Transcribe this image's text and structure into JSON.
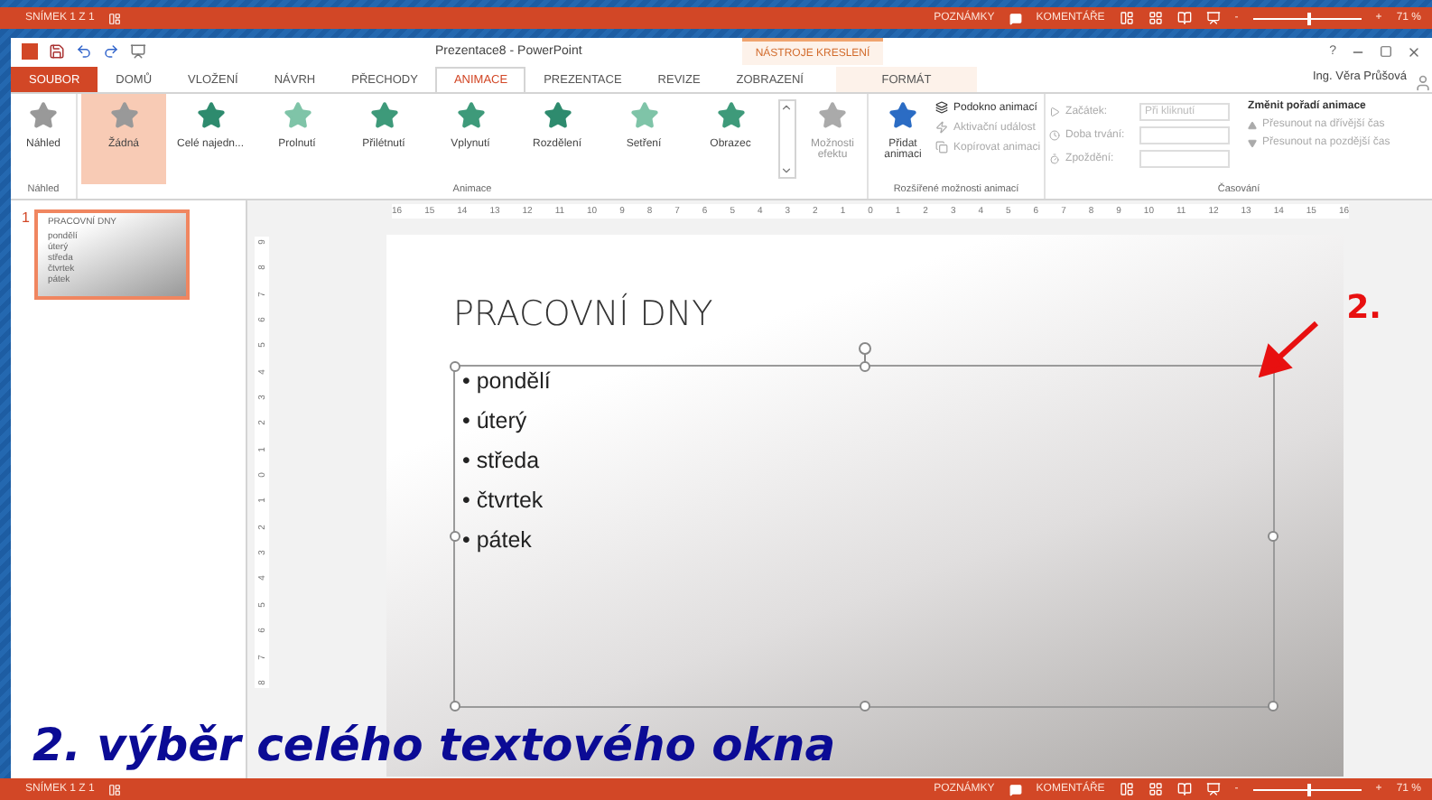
{
  "top_status_bar": {
    "slide_counter": "SNÍMEK 1 Z 1",
    "notes": "POZNÁMKY",
    "comments": "KOMENTÁŘE",
    "zoom_minus": "-",
    "zoom_plus": "+",
    "zoom": {
      "level": 0.5
    },
    "zoom_reading": "71 %"
  },
  "window": {
    "title": "Prezentace8 - PowerPoint",
    "contextual_group": "NÁSTROJE KRESLENÍ",
    "help": "?",
    "user": "Ing. Věra Průšová"
  },
  "tabs": [
    {
      "label": "SOUBOR",
      "kind": "file",
      "selected": false
    },
    {
      "label": "DOMŮ",
      "kind": "normal",
      "selected": false
    },
    {
      "label": "VLOŽENÍ",
      "kind": "normal",
      "selected": false
    },
    {
      "label": "NÁVRH",
      "kind": "normal",
      "selected": false
    },
    {
      "label": "PŘECHODY",
      "kind": "normal",
      "selected": false
    },
    {
      "label": "ANIMACE",
      "kind": "normal",
      "selected": true
    },
    {
      "label": "PREZENTACE",
      "kind": "normal",
      "selected": false
    },
    {
      "label": "REVIZE",
      "kind": "normal",
      "selected": false
    },
    {
      "label": "ZOBRAZENÍ",
      "kind": "normal",
      "selected": false
    },
    {
      "label": "FORMÁT",
      "kind": "contextual",
      "selected": false
    }
  ],
  "ribbon": {
    "preview": {
      "button": "Náhled",
      "group_label": "Náhled"
    },
    "animations": {
      "group_label": "Animace",
      "effect_options": "Možnosti efektu",
      "gallery": [
        {
          "label": "Žádná",
          "selected": true,
          "kind": "none"
        },
        {
          "label": "Celé najedn...",
          "selected": false,
          "kind": "burst"
        },
        {
          "label": "Prolnutí",
          "selected": false,
          "kind": "fade"
        },
        {
          "label": "Přilétnutí",
          "selected": false,
          "kind": "fly"
        },
        {
          "label": "Vplynutí",
          "selected": false,
          "kind": "fly"
        },
        {
          "label": "Rozdělení",
          "selected": false,
          "kind": "split"
        },
        {
          "label": "Setření",
          "selected": false,
          "kind": "fade"
        },
        {
          "label": "Obrazec",
          "selected": false,
          "kind": "shape"
        }
      ]
    },
    "advanced": {
      "group_label": "Rozšířené možnosti animací",
      "add_animation": "Přidat animaci",
      "items": [
        {
          "label": "Podokno animací",
          "disabled": false
        },
        {
          "label": "Aktivační událost",
          "disabled": true
        },
        {
          "label": "Kopírovat animaci",
          "disabled": true
        }
      ]
    },
    "timing": {
      "group_label": "Časování",
      "start_label": "Začátek:",
      "start_value": "Při kliknutí",
      "duration_label": "Doba trvání:",
      "delay_label": "Zpoždění:",
      "reorder_title": "Změnit pořadí animace",
      "moves": [
        {
          "label": "Přesunout na dřívější čas"
        },
        {
          "label": "Přesunout na pozdější čas"
        }
      ]
    }
  },
  "thumbnail": {
    "number": "1",
    "title": "PRACOVNÍ DNY",
    "bullets": [
      "pondělí",
      "úterý",
      "středa",
      "čtvrtek",
      "pátek"
    ],
    "selected": true
  },
  "horizontal_ruler": [
    "16",
    "15",
    "14",
    "13",
    "12",
    "11",
    "10",
    "9",
    "8",
    "7",
    "6",
    "5",
    "4",
    "3",
    "2",
    "1",
    "0",
    "1",
    "2",
    "3",
    "4",
    "5",
    "6",
    "7",
    "8",
    "9",
    "10",
    "11",
    "12",
    "13",
    "14",
    "15",
    "16"
  ],
  "vertical_ruler": [
    "9",
    "8",
    "7",
    "6",
    "5",
    "4",
    "3",
    "2",
    "1",
    "0",
    "1",
    "2",
    "3",
    "4",
    "5",
    "6",
    "7",
    "8"
  ],
  "slide": {
    "title": "PRACOVNÍ DNY",
    "bullets": [
      "• pondělí",
      "• úterý",
      "• středa",
      "• čtvrtek",
      "• pátek"
    ]
  },
  "annotation": {
    "label": "2."
  },
  "caption": "2. výběr celého textového okna",
  "bottom_status_bar": {
    "slide_counter": "SNÍMEK 1 Z 1",
    "notes": "POZNÁMKY",
    "comments": "KOMENTÁŘE",
    "zoom_minus": "-",
    "zoom_plus": "+",
    "zoom": {
      "level": 0.5
    },
    "zoom_reading": "71 %"
  }
}
